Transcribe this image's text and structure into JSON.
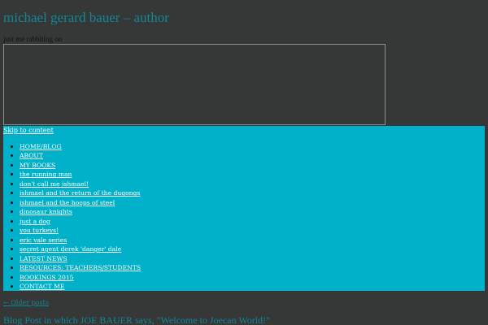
{
  "site": {
    "title": "michael gerard bauer – author",
    "tagline": "just me rabbiting on"
  },
  "nav": {
    "skip_link": "Skip to content",
    "items": [
      {
        "label": "HOME/BLOG"
      },
      {
        "label": "ABOUT"
      },
      {
        "label": "MY BOOKS"
      },
      {
        "label": "the running man"
      },
      {
        "label": "don't call me ishmael!"
      },
      {
        "label": "ishmael and the return of the dugongs"
      },
      {
        "label": "ishmael and the hoops of steel"
      },
      {
        "label": "dinosaur knights"
      },
      {
        "label": "just a dog"
      },
      {
        "label": "you turkeys!"
      },
      {
        "label": "eric vale series"
      },
      {
        "label": "secret agent derek 'danger' dale"
      },
      {
        "label": "LATEST NEWS"
      },
      {
        "label": "RESOURCES: TEACHERS/STUDENTS"
      },
      {
        "label": "BOOKINGS 2015"
      },
      {
        "label": "CONTACT ME"
      }
    ]
  },
  "content": {
    "older_posts": "← Older posts",
    "post_title": "Blog Post in which JOE BAUER says, \"Welcome to Joecan World!\""
  },
  "colors": {
    "background": "#363838",
    "accent": "#0f8796",
    "nav_background": "#00b1c9"
  }
}
